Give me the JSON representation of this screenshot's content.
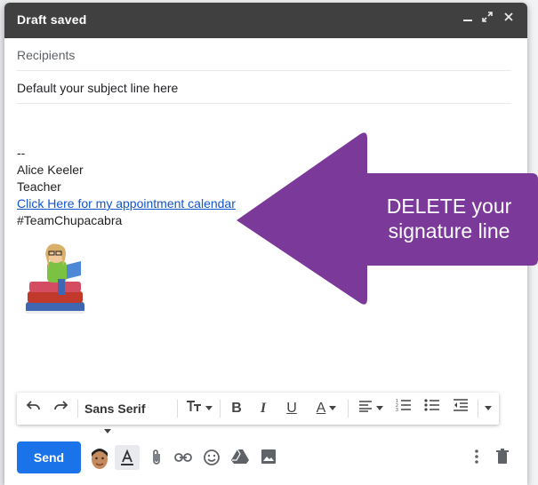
{
  "window": {
    "title": "Draft saved",
    "minimize_icon": "minimize-icon",
    "expand_icon": "expand-icon",
    "close_icon": "close-icon"
  },
  "compose": {
    "recipients_placeholder": "Recipients",
    "subject": "Default your subject line here"
  },
  "signature": {
    "dashes": "--",
    "name": "Alice Keeler",
    "role": "Teacher",
    "link_text": "Click Here for my appointment calendar",
    "hashtag": "#TeamChupacabra"
  },
  "callout": {
    "line1": "DELETE your",
    "line2": "signature line",
    "color": "#7b3a9a"
  },
  "toolbar": {
    "font": "Sans Serif",
    "icons": [
      "undo-icon",
      "redo-icon",
      "font-size-icon",
      "bold-icon",
      "italic-icon",
      "underline-icon",
      "text-color-icon",
      "align-icon",
      "numbered-list-icon",
      "bulleted-list-icon",
      "indent-less-icon",
      "more-formatting-icon"
    ]
  },
  "bottom": {
    "send_label": "Send",
    "send_color": "#1a73e8",
    "icons": [
      "avatar",
      "formatting-toggle-icon",
      "attach-icon",
      "link-icon",
      "emoji-icon",
      "drive-icon",
      "photo-icon",
      "more-options-icon",
      "trash-icon"
    ]
  }
}
